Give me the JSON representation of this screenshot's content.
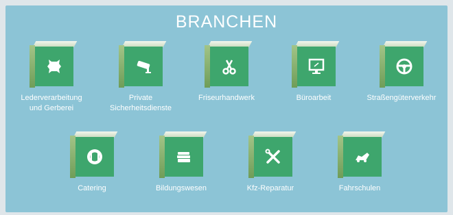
{
  "title": "BRANCHEN",
  "row1": [
    {
      "line1": "Lederverarbeitung",
      "line2": "und Gerberei",
      "icon": "leather-hide-icon"
    },
    {
      "line1": "Private",
      "line2": "Sicherheitsdienste",
      "icon": "security-camera-icon"
    },
    {
      "line1": "Friseurhandwerk",
      "line2": "",
      "icon": "scissors-icon"
    },
    {
      "line1": "Büroarbeit",
      "line2": "",
      "icon": "monitor-icon"
    },
    {
      "line1": "Straßengüterverkehr",
      "line2": "",
      "icon": "steering-wheel-icon"
    }
  ],
  "row2": [
    {
      "line1": "Catering",
      "line2": "",
      "icon": "plate-cutlery-icon"
    },
    {
      "line1": "Bildungswesen",
      "line2": "",
      "icon": "books-icon"
    },
    {
      "line1": "Kfz-Reparatur",
      "line2": "",
      "icon": "wrench-screwdriver-icon"
    },
    {
      "line1": "Fahrschulen",
      "line2": "",
      "icon": "learner-driver-icon"
    }
  ],
  "colors": {
    "panel": "#8cc4d6",
    "tile_front": "#3ea66d",
    "text": "#ffffff"
  }
}
